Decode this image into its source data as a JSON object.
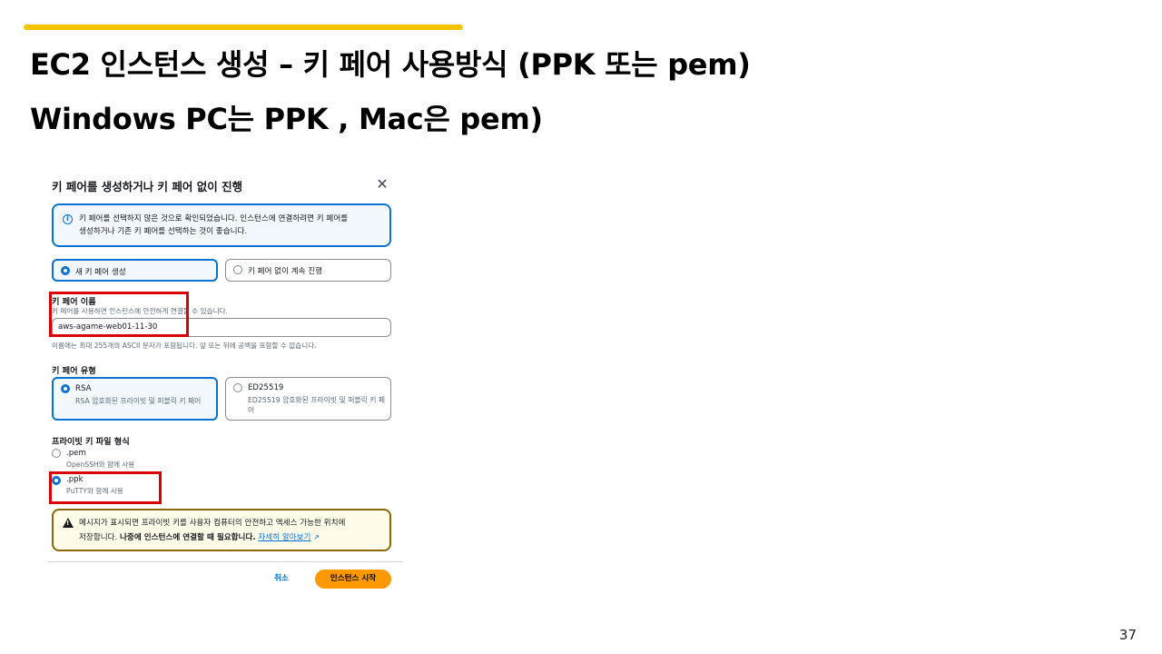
{
  "slide": {
    "title_line1": "EC2 인스턴스 생성 – 키 페어 사용방식 (PPK 또는 pem)",
    "title_line2": "Windows PC는 PPK  , Mac은 pem)",
    "page_number": "37",
    "accent_color": "#f5c200"
  },
  "modal": {
    "header": "키 페어를 생성하거나 키 페어 없이 진행",
    "close_icon": "close-icon",
    "info": {
      "icon": "info-icon",
      "line1": "키 페어를 선택하지 않은 것으로 확인되었습니다. 인스턴스에 연결하려면 키 페어를",
      "line2": "생성하거나 기존 키 페어를 선택하는 것이 좋습니다."
    },
    "mode_options": [
      {
        "label": "새 키 페어 생성",
        "selected": true
      },
      {
        "label": "키 페어 없이 계속 진행",
        "selected": false
      }
    ],
    "key_name": {
      "label": "키 페어 이름",
      "description": "키 페어를 사용하면 인스턴스에 안전하게 연결할 수 있습니다.",
      "value": "aws-agame-web01-11-30",
      "constraint": "이름에는 최대 255개의 ASCII 문자가 포함됩니다. 앞 또는 뒤에 공백을 포함할 수 없습니다."
    },
    "key_type": {
      "label": "키 페어 유형",
      "options": [
        {
          "label": "RSA",
          "desc": "RSA 암호화된 프라이빗 및 퍼블릭 키 페어",
          "selected": true
        },
        {
          "label": "ED25519",
          "desc": "ED25519 암호화된 프라이빗 및 퍼블릭 키 페어",
          "selected": false
        }
      ]
    },
    "file_format": {
      "label": "프라이빗 키 파일 형식",
      "options": [
        {
          "label": ".pem",
          "desc": "OpenSSH와 함께 사용",
          "selected": false
        },
        {
          "label": ".ppk",
          "desc": "PuTTY와 함께 사용",
          "selected": true
        }
      ]
    },
    "warning": {
      "icon": "warning-icon",
      "line1": "메시지가 표시되면 프라이빗 키를 사용자 컴퓨터의 안전하고 액세스 가능한 위치에",
      "line2_a": "저장합니다.",
      "line2_b": "나중에 인스턴스에 연결할 때 필요합니다.",
      "link": "자세히 알아보기",
      "link_icon": "external-link-icon"
    },
    "cancel_label": "취소",
    "primary_label": "인스턴스 시작",
    "primary_color": "#ff9900",
    "highlight_color": "#d90000"
  }
}
